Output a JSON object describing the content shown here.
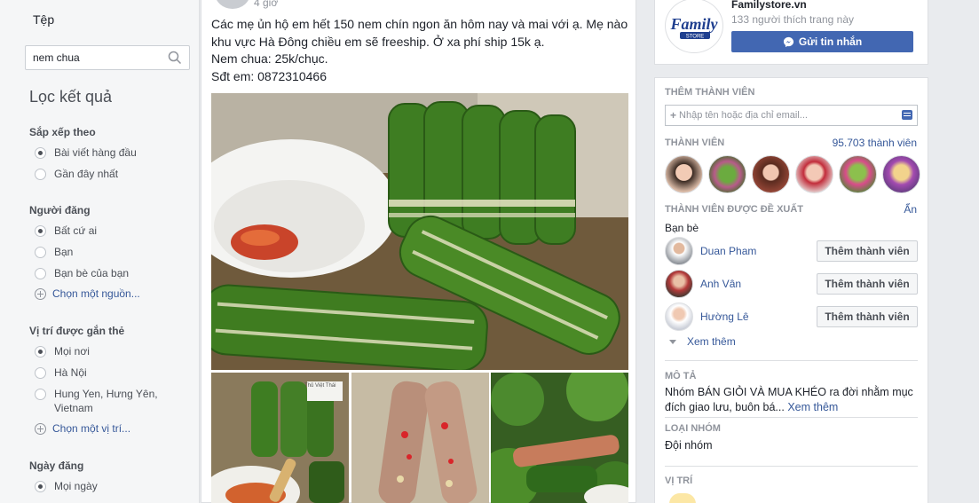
{
  "sidebar": {
    "files_label": "Tệp",
    "search": {
      "value": "nem chua"
    },
    "filter_title": "Lọc kết quả",
    "sort": {
      "title": "Sắp xếp theo",
      "options": [
        {
          "label": "Bài viết hàng đầu",
          "selected": true
        },
        {
          "label": "Gần đây nhất",
          "selected": false
        }
      ]
    },
    "poster": {
      "title": "Người đăng",
      "options": [
        {
          "label": "Bất cứ ai",
          "selected": true
        },
        {
          "label": "Bạn",
          "selected": false
        },
        {
          "label": "Bạn bè của bạn",
          "selected": false
        }
      ],
      "choose": "Chọn một nguồn..."
    },
    "location": {
      "title": "Vị trí được gắn thẻ",
      "options": [
        {
          "label": "Mọi nơi",
          "selected": true
        },
        {
          "label": "Hà Nội",
          "selected": false
        },
        {
          "label": "Hung Yen, Hưng Yên, Vietnam",
          "selected": false
        }
      ],
      "choose": "Chọn một vị trí..."
    },
    "date": {
      "title": "Ngày đăng",
      "options": [
        {
          "label": "Mọi ngày",
          "selected": true
        }
      ]
    }
  },
  "post": {
    "time": "4 giờ",
    "lines": [
      "Các mẹ ủn hộ em hết 150 nem chín ngon ăn hôm nay và mai với ạ. Mẹ nào khu vực Hà Đông chiều em sẽ freeship. Ở xa phí ship 15k ạ.",
      "Nem chua: 25k/chục.",
      "Sđt em: 0872310466"
    ],
    "photo_caption_small": "Thủ Việt Thái"
  },
  "page": {
    "logo_text": "Family",
    "logo_sub": "STORE",
    "name": "Familystore.vn",
    "likes": "133 người thích trang này",
    "message_button": "Gửi tin nhắn"
  },
  "group": {
    "add_member_heading": "THÊM THÀNH VIÊN",
    "add_member_placeholder": "Nhập tên hoặc địa chỉ email...",
    "members_heading": "THÀNH VIÊN",
    "member_count": "95.703 thành viên",
    "suggested_heading": "THÀNH VIÊN ĐƯỢC ĐỀ XUẤT",
    "hide_link": "Ẩn",
    "friends_label": "Bạn bè",
    "suggestions": [
      {
        "name": "Duan Pham",
        "button": "Thêm thành viên"
      },
      {
        "name": "Anh Vân",
        "button": "Thêm thành viên"
      },
      {
        "name": "Hường Lê",
        "button": "Thêm thành viên"
      }
    ],
    "see_more": "Xem thêm",
    "description_heading": "MÔ TẢ",
    "description": "Nhóm BÁN GIỎI VÀ MUA KHÉO ra đời nhằm mục đích giao lưu, buôn bá...",
    "description_more": "Xem thêm",
    "group_type_heading": "LOẠI NHÓM",
    "group_type": "Đội nhóm",
    "location_heading": "VỊ TRÍ"
  },
  "colors": {
    "brand_blue": "#4267b2",
    "link_blue": "#365899",
    "leaf_green": "#3d7a22"
  }
}
